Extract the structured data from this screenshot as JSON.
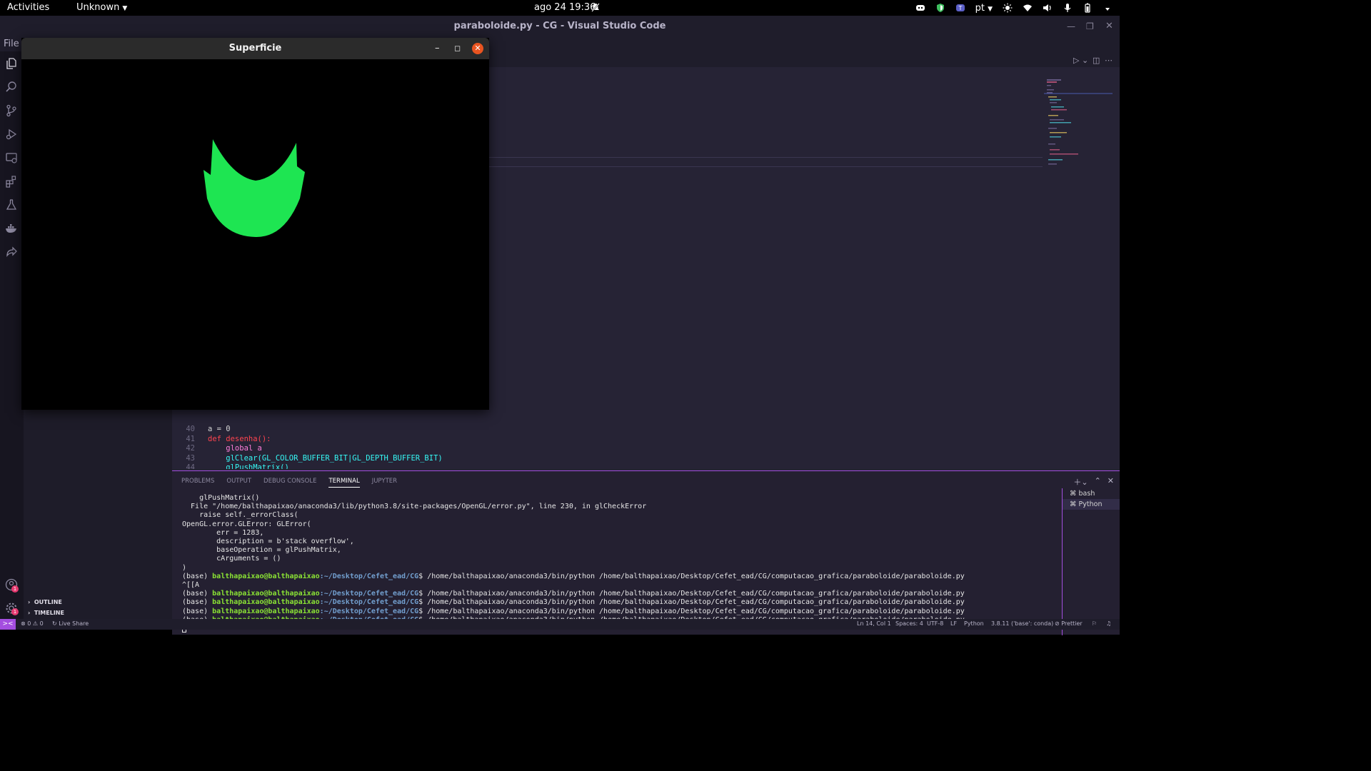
{
  "topbar": {
    "activities": "Activities",
    "app_menu": "Unknown",
    "clock": "ago 24  19:36",
    "language": "pt",
    "tray_icons": [
      "discord-icon",
      "shield-icon",
      "teams-icon",
      "brightness-icon",
      "wifi-icon",
      "volume-icon",
      "mic-icon",
      "battery-icon"
    ]
  },
  "vscode": {
    "title": "paraboloide.py - CG - Visual Studio Code",
    "menu": {
      "file": "File"
    },
    "sidebar": {
      "outline": "OUTLINE",
      "timeline": "TIMELINE"
    },
    "activity_badges": {
      "accounts": "1",
      "settings": "1"
    }
  },
  "code_lines": [
    {
      "num": "40",
      "text": "a = 0"
    },
    {
      "num": "41",
      "text": "def desenha():"
    },
    {
      "num": "42",
      "text": "    global a"
    },
    {
      "num": "43",
      "text": "    glClear(GL_COLOR_BUFFER_BIT|GL_DEPTH_BUFFER_BIT)"
    },
    {
      "num": "44",
      "text": "    glPushMatrix()"
    }
  ],
  "panel": {
    "tabs": [
      "PROBLEMS",
      "OUTPUT",
      "DEBUG CONSOLE",
      "TERMINAL",
      "JUPYTER"
    ],
    "active_tab": "TERMINAL",
    "terminals": [
      "bash",
      "Python"
    ]
  },
  "terminal": {
    "lines": [
      "    glPushMatrix()",
      "  File \"/home/balthapaixao/anaconda3/lib/python3.8/site-packages/OpenGL/error.py\", line 230, in glCheckError",
      "    raise self._errorClass(",
      "OpenGL.error.GLError: GLError(",
      "        err = 1283,",
      "        description = b'stack overflow',",
      "        baseOperation = glPushMatrix,",
      "        cArguments = ()",
      ")"
    ],
    "prompt_env": "(base) ",
    "prompt_user": "balthapaixao@balthapaixao",
    "prompt_path": ":~/Desktop/Cefet_ead/CG",
    "prompt_symbol": "$ ",
    "command": "/home/balthapaixao/anaconda3/bin/python /home/balthapaixao/Desktop/Cefet_ead/CG/computacao_grafica/paraboloide/paraboloide.py",
    "escape_line": "^[[A"
  },
  "statusbar": {
    "remote": "><",
    "problems": "⊗ 0 ⚠ 0",
    "live_share": "Live Share",
    "position": "Ln 14, Col 1",
    "spaces": "Spaces: 4",
    "encoding": "UTF-8",
    "eol": "LF",
    "language": "Python",
    "interpreter": "3.8.11 ('base': conda)",
    "prettier": "Prettier"
  },
  "gl_window": {
    "title": "Superficie",
    "shape_color": "#1ee552"
  }
}
